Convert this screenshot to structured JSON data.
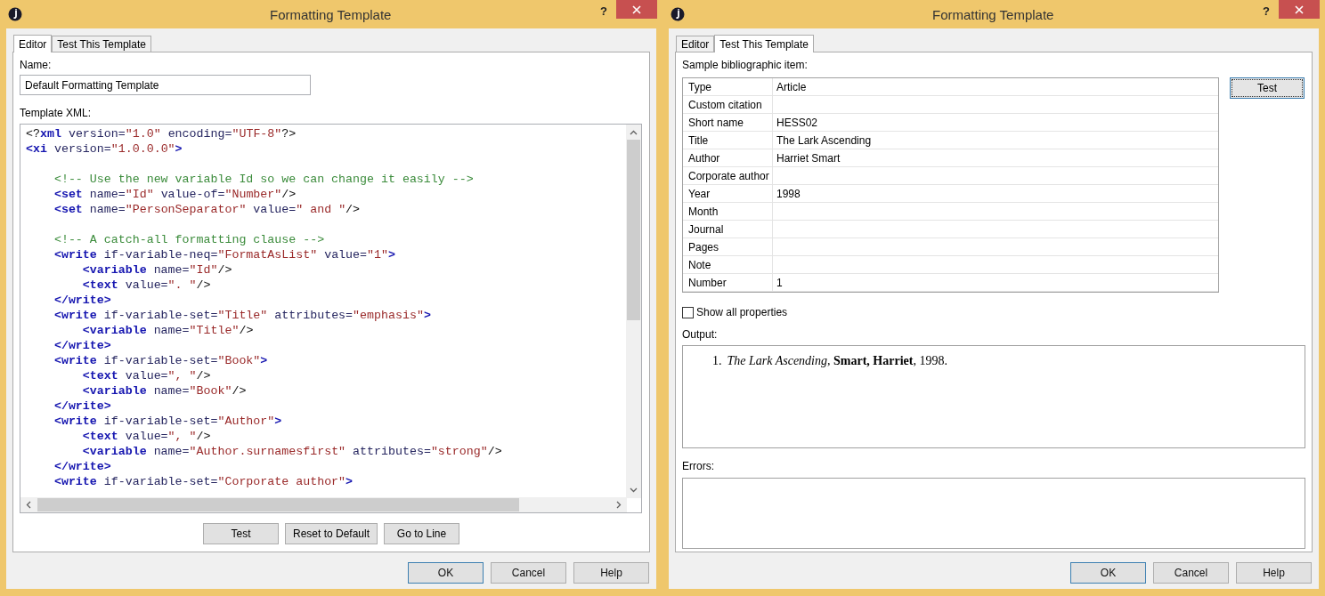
{
  "windows": [
    {
      "title": "Formatting Template",
      "help_glyph": "?",
      "tabs": [
        {
          "label": "Editor",
          "selected": true
        },
        {
          "label": "Test This Template",
          "selected": false
        }
      ],
      "panel": {
        "kind": "editor",
        "name_label": "Name:",
        "name_value": "Default Formatting Template",
        "xml_label": "Template XML:",
        "code_lines": [
          [
            {
              "kind": "punct",
              "text": "<?"
            },
            {
              "kind": "tag",
              "text": "xml"
            },
            {
              "kind": "attr",
              "text": " version="
            },
            {
              "kind": "value",
              "text": "\"1.0\""
            },
            {
              "kind": "attr",
              "text": " encoding="
            },
            {
              "kind": "value",
              "text": "\"UTF-8\""
            },
            {
              "kind": "punct",
              "text": "?>"
            }
          ],
          [
            {
              "kind": "tag",
              "text": "<xi"
            },
            {
              "kind": "attr",
              "text": " version="
            },
            {
              "kind": "value",
              "text": "\"1.0.0.0\""
            },
            {
              "kind": "tag",
              "text": ">"
            }
          ],
          [
            {
              "kind": "blank"
            }
          ],
          [
            {
              "kind": "comment",
              "text": "    <!-- Use the new variable Id so we can change it easily -->"
            }
          ],
          [
            {
              "kind": "tag",
              "text": "    <set"
            },
            {
              "kind": "attr",
              "text": " name="
            },
            {
              "kind": "value",
              "text": "\"Id\""
            },
            {
              "kind": "attr",
              "text": " value-of="
            },
            {
              "kind": "value",
              "text": "\"Number\""
            },
            {
              "kind": "punct",
              "text": "/>"
            }
          ],
          [
            {
              "kind": "tag",
              "text": "    <set"
            },
            {
              "kind": "attr",
              "text": " name="
            },
            {
              "kind": "value",
              "text": "\"PersonSeparator\""
            },
            {
              "kind": "attr",
              "text": " value="
            },
            {
              "kind": "value",
              "text": "\" and \""
            },
            {
              "kind": "punct",
              "text": "/>"
            }
          ],
          [
            {
              "kind": "blank"
            }
          ],
          [
            {
              "kind": "comment",
              "text": "    <!-- A catch-all formatting clause -->"
            }
          ],
          [
            {
              "kind": "tag",
              "text": "    <write"
            },
            {
              "kind": "attr",
              "text": " if-variable-neq="
            },
            {
              "kind": "value",
              "text": "\"FormatAsList\""
            },
            {
              "kind": "attr",
              "text": " value="
            },
            {
              "kind": "value",
              "text": "\"1\""
            },
            {
              "kind": "tag",
              "text": ">"
            }
          ],
          [
            {
              "kind": "tag",
              "text": "        <variable"
            },
            {
              "kind": "attr",
              "text": " name="
            },
            {
              "kind": "value",
              "text": "\"Id\""
            },
            {
              "kind": "punct",
              "text": "/>"
            }
          ],
          [
            {
              "kind": "tag",
              "text": "        <text"
            },
            {
              "kind": "attr",
              "text": " value="
            },
            {
              "kind": "value",
              "text": "\". \""
            },
            {
              "kind": "punct",
              "text": "/>"
            }
          ],
          [
            {
              "kind": "tag",
              "text": "    </write>"
            }
          ],
          [
            {
              "kind": "tag",
              "text": "    <write"
            },
            {
              "kind": "attr",
              "text": " if-variable-set="
            },
            {
              "kind": "value",
              "text": "\"Title\""
            },
            {
              "kind": "attr",
              "text": " attributes="
            },
            {
              "kind": "value",
              "text": "\"emphasis\""
            },
            {
              "kind": "tag",
              "text": ">"
            }
          ],
          [
            {
              "kind": "tag",
              "text": "        <variable"
            },
            {
              "kind": "attr",
              "text": " name="
            },
            {
              "kind": "value",
              "text": "\"Title\""
            },
            {
              "kind": "punct",
              "text": "/>"
            }
          ],
          [
            {
              "kind": "tag",
              "text": "    </write>"
            }
          ],
          [
            {
              "kind": "tag",
              "text": "    <write"
            },
            {
              "kind": "attr",
              "text": " if-variable-set="
            },
            {
              "kind": "value",
              "text": "\"Book\""
            },
            {
              "kind": "tag",
              "text": ">"
            }
          ],
          [
            {
              "kind": "tag",
              "text": "        <text"
            },
            {
              "kind": "attr",
              "text": " value="
            },
            {
              "kind": "value",
              "text": "\", \""
            },
            {
              "kind": "punct",
              "text": "/>"
            }
          ],
          [
            {
              "kind": "tag",
              "text": "        <variable"
            },
            {
              "kind": "attr",
              "text": " name="
            },
            {
              "kind": "value",
              "text": "\"Book\""
            },
            {
              "kind": "punct",
              "text": "/>"
            }
          ],
          [
            {
              "kind": "tag",
              "text": "    </write>"
            }
          ],
          [
            {
              "kind": "tag",
              "text": "    <write"
            },
            {
              "kind": "attr",
              "text": " if-variable-set="
            },
            {
              "kind": "value",
              "text": "\"Author\""
            },
            {
              "kind": "tag",
              "text": ">"
            }
          ],
          [
            {
              "kind": "tag",
              "text": "        <text"
            },
            {
              "kind": "attr",
              "text": " value="
            },
            {
              "kind": "value",
              "text": "\", \""
            },
            {
              "kind": "punct",
              "text": "/>"
            }
          ],
          [
            {
              "kind": "tag",
              "text": "        <variable"
            },
            {
              "kind": "attr",
              "text": " name="
            },
            {
              "kind": "value",
              "text": "\"Author.surnamesfirst\""
            },
            {
              "kind": "attr",
              "text": " attributes="
            },
            {
              "kind": "value",
              "text": "\"strong\""
            },
            {
              "kind": "punct",
              "text": "/>"
            }
          ],
          [
            {
              "kind": "tag",
              "text": "    </write>"
            }
          ],
          [
            {
              "kind": "tag",
              "text": "    <write"
            },
            {
              "kind": "attr",
              "text": " if-variable-set="
            },
            {
              "kind": "value",
              "text": "\"Corporate author\""
            },
            {
              "kind": "tag",
              "text": ">"
            }
          ]
        ],
        "actions": [
          {
            "label": "Test"
          },
          {
            "label": "Reset to Default"
          },
          {
            "label": "Go to Line"
          }
        ]
      },
      "buttons": [
        {
          "label": "OK",
          "default": true
        },
        {
          "label": "Cancel",
          "default": false
        },
        {
          "label": "Help",
          "default": false
        }
      ]
    },
    {
      "title": "Formatting Template",
      "help_glyph": "?",
      "tabs": [
        {
          "label": "Editor",
          "selected": false
        },
        {
          "label": "Test This Template",
          "selected": true
        }
      ],
      "panel": {
        "kind": "test",
        "sample_label": "Sample bibliographic item:",
        "rows": [
          {
            "name": "Type",
            "value": "Article"
          },
          {
            "name": "Custom citation"
          },
          {
            "name": "Short name",
            "value": "HESS02"
          },
          {
            "name": "Title",
            "value": "The Lark Ascending"
          },
          {
            "name": "Author",
            "value": "Harriet Smart"
          },
          {
            "name": "Corporate author"
          },
          {
            "name": "Year",
            "value": "1998"
          },
          {
            "name": "Month"
          },
          {
            "name": "Journal"
          },
          {
            "name": "Pages"
          },
          {
            "name": "Note"
          },
          {
            "name": "Number",
            "value": "1"
          }
        ],
        "test_button": {
          "label": "Test",
          "default": true
        },
        "show_all": {
          "label": "Show all properties",
          "checked": false
        },
        "output_label": "Output:",
        "output": [
          {
            "number": "1.",
            "text": "*The Lark Ascending*, **Smart, Harriet**, 1998."
          }
        ],
        "errors_label": "Errors:"
      },
      "buttons": [
        {
          "label": "OK",
          "default": true
        },
        {
          "label": "Cancel",
          "default": false
        },
        {
          "label": "Help",
          "default": false
        }
      ]
    }
  ]
}
